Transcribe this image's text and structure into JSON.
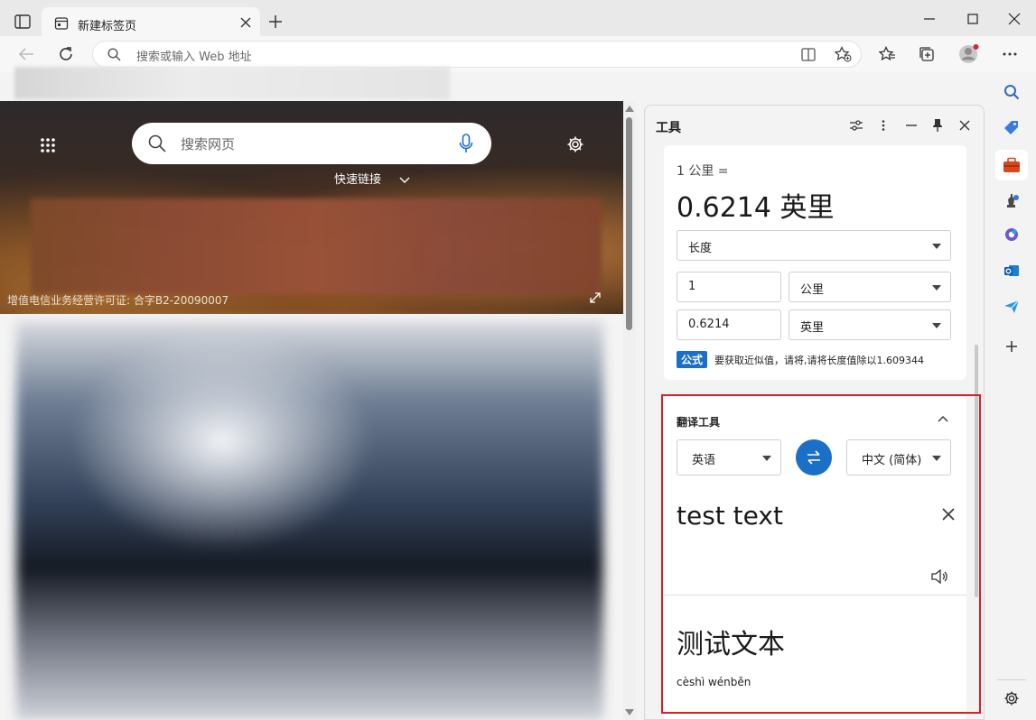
{
  "browser": {
    "tab_title": "新建标签页",
    "address_placeholder": "搜索或输入 Web 地址"
  },
  "newtab": {
    "search_placeholder": "搜索网页",
    "quick_links": "快速链接",
    "license": "增值电信业务经营许可证: 合字B2-20090007"
  },
  "pane": {
    "title": "工具",
    "unit": {
      "from_line": "1 公里 =",
      "result": "0.6214 英里",
      "category": "长度",
      "from_value": "1",
      "from_unit": "公里",
      "to_value": "0.6214",
      "to_unit": "英里",
      "formula_badge": "公式",
      "formula_text": "要获取近似值，请将,请将长度值除以1.609344"
    },
    "translate": {
      "title": "翻译工具",
      "source_lang": "英语",
      "target_lang": "中文 (简体)",
      "source_text": "test text",
      "target_text": "测试文本",
      "pinyin": "cèshì wénběn"
    }
  },
  "colors": {
    "accent": "#1a6fc9",
    "highlight_border": "#d4202a"
  }
}
